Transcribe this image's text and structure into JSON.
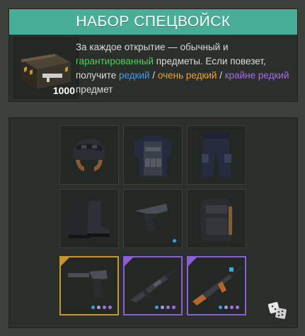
{
  "header": {
    "title": "НАБОР СПЕЦВОЙСК"
  },
  "crate": {
    "price": "1000",
    "icon": "crate-icon"
  },
  "description": {
    "p1": "За каждое открытие — обычный и ",
    "guaranteed": "гарантированный",
    "p2": " предметы. Если повезет, получите ",
    "rare": "редкий",
    "sep1": " / ",
    "very_rare": "очень редкий",
    "sep2": " / ",
    "extremely_rare": "крайне редкий",
    "p3": " предмет"
  },
  "colors": {
    "title_bar": "#48ae97",
    "guaranteed": "#4cd05e",
    "rare": "#3f9bea",
    "very_rare": "#e9a23b",
    "extremely_rare": "#a46ee4"
  },
  "items": [
    {
      "icon": "helmet-icon",
      "rarity": "common"
    },
    {
      "icon": "tactical-vest-icon",
      "rarity": "common"
    },
    {
      "icon": "cargo-pants-icon",
      "rarity": "common"
    },
    {
      "icon": "combat-boots-icon",
      "rarity": "common"
    },
    {
      "icon": "pistol-icon",
      "rarity": "rare"
    },
    {
      "icon": "backpack-icon",
      "rarity": "common"
    },
    {
      "icon": "silenced-pistol-icon",
      "rarity": "very-rare"
    },
    {
      "icon": "assault-rifle-icon",
      "rarity": "extremely-rare"
    },
    {
      "icon": "ak-rifle-icon",
      "rarity": "extremely-rare"
    }
  ],
  "dice_icon": "dice-icon"
}
